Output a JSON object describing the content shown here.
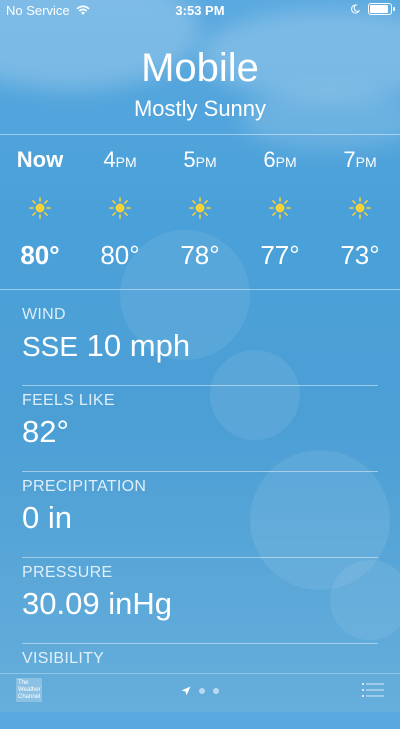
{
  "status_bar": {
    "carrier": "No Service",
    "time": "3:53 PM",
    "battery_level": 1.0
  },
  "location": {
    "city": "Mobile",
    "condition": "Mostly Sunny"
  },
  "hourly": [
    {
      "label": "Now",
      "suffix": "",
      "temp": "80°",
      "icon": "sun-icon",
      "highlight": true
    },
    {
      "label": "4",
      "suffix": "PM",
      "temp": "80°",
      "icon": "sun-icon",
      "highlight": false
    },
    {
      "label": "5",
      "suffix": "PM",
      "temp": "78°",
      "icon": "sun-icon",
      "highlight": false
    },
    {
      "label": "6",
      "suffix": "PM",
      "temp": "77°",
      "icon": "sun-icon",
      "highlight": false
    },
    {
      "label": "7",
      "suffix": "PM",
      "temp": "73°",
      "icon": "sun-icon",
      "highlight": false
    }
  ],
  "details": {
    "wind": {
      "label": "WIND",
      "direction": "SSE",
      "value": "10 mph"
    },
    "feels_like": {
      "label": "FEELS LIKE",
      "value": "82°"
    },
    "precipitation": {
      "label": "PRECIPITATION",
      "value": "0 in"
    },
    "pressure": {
      "label": "PRESSURE",
      "value": "30.09 inHg"
    },
    "visibility": {
      "label": "VISIBILITY"
    }
  },
  "footer": {
    "logo_text": "The Weather Channel",
    "page_count": 3,
    "active_page": 0
  },
  "colors": {
    "sun": "#f6d23a",
    "sky_top": "#5aa9e0",
    "sky_bottom": "#66aedb"
  }
}
